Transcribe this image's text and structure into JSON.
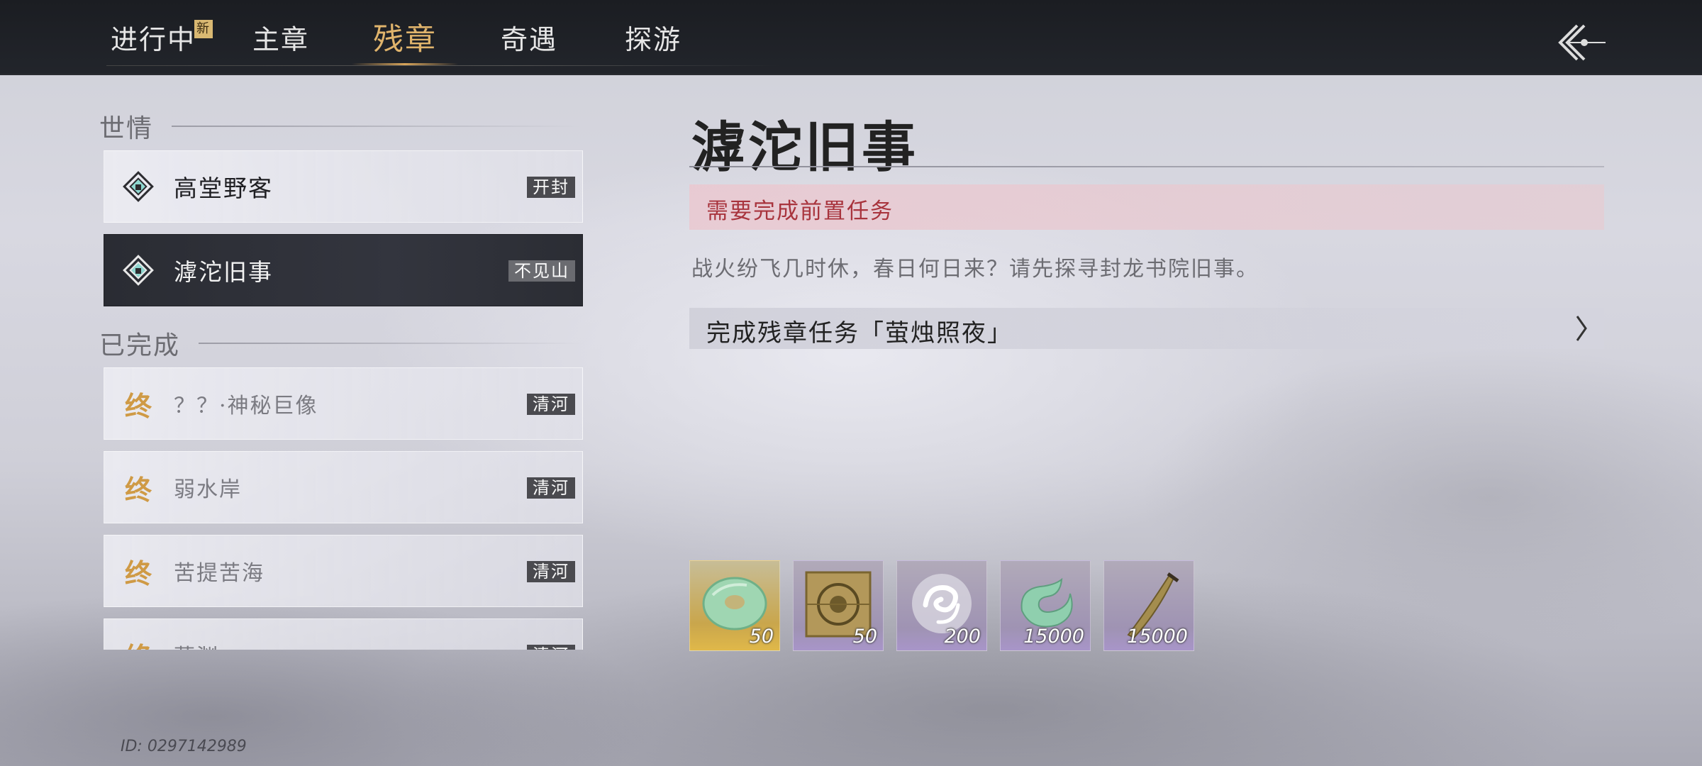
{
  "tabs": [
    {
      "label": "进行中",
      "badge": "新"
    },
    {
      "label": "主章"
    },
    {
      "label": "残章"
    },
    {
      "label": "奇遇"
    },
    {
      "label": "探游"
    }
  ],
  "left": {
    "section_ongoing": "世情",
    "section_done": "已完成",
    "ongoing": [
      {
        "name": "高堂野客",
        "tag": "开封",
        "icon": "diamond-lock-icon"
      },
      {
        "name": "滹沱旧事",
        "tag": "不见山",
        "icon": "diamond-lock-icon"
      }
    ],
    "done_mark": "终",
    "done": [
      {
        "name": "？？·神秘巨像",
        "tag": "清河"
      },
      {
        "name": "弱水岸",
        "tag": "清河"
      },
      {
        "name": "苦提苦海",
        "tag": "清河"
      },
      {
        "name": "慕渊",
        "tag": "清河"
      }
    ]
  },
  "detail": {
    "title": "滹沱旧事",
    "prereq": "需要完成前置任务",
    "description": "战火纷飞几时休，春日何日来？请先探寻封龙书院旧事。",
    "task": "完成残章任务「萤烛照夜」"
  },
  "rewards": [
    {
      "icon": "jade-disc-icon",
      "qty": "50",
      "rarity": "gold"
    },
    {
      "icon": "bronze-seal-icon",
      "qty": "50",
      "rarity": "purple"
    },
    {
      "icon": "white-swirl-orb-icon",
      "qty": "200",
      "rarity": "purple"
    },
    {
      "icon": "jade-cloud-icon",
      "qty": "15000",
      "rarity": "purple"
    },
    {
      "icon": "blade-icon",
      "qty": "15000",
      "rarity": "purple"
    }
  ],
  "user_id": "ID: 0297142989",
  "colors": {
    "accent_tab": "#e0b46c",
    "prereq_text": "#a8343d",
    "done_mark": "#cf9a45"
  }
}
